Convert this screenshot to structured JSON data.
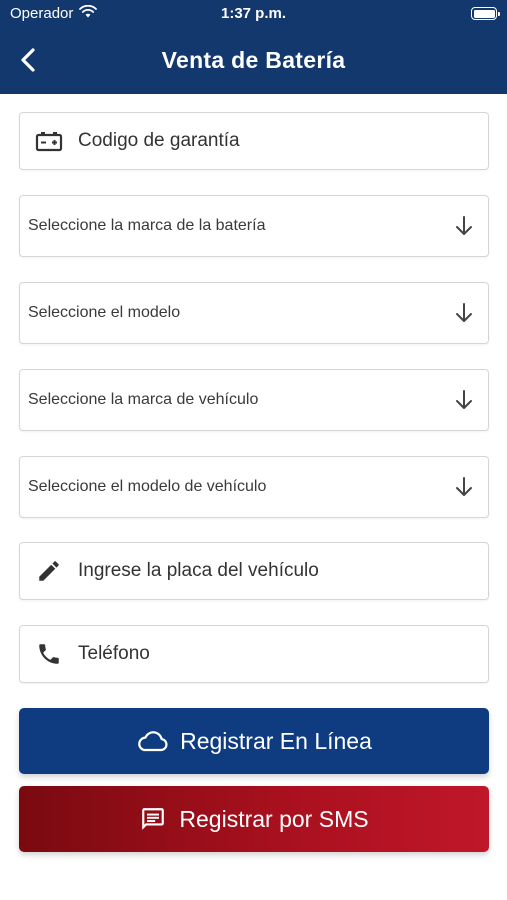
{
  "status_bar": {
    "carrier": "Operador",
    "time": "1:37 p.m."
  },
  "header": {
    "title": "Venta de Batería",
    "back_icon": "chevron-left-icon"
  },
  "form": {
    "warranty_code": {
      "placeholder": "Codigo de garantía",
      "icon": "battery-icon"
    },
    "battery_brand": {
      "placeholder": "Seleccione la marca de la batería",
      "icon": "arrow-down-icon"
    },
    "model": {
      "placeholder": "Seleccione el modelo",
      "icon": "arrow-down-icon"
    },
    "vehicle_brand": {
      "placeholder": "Seleccione la marca de vehículo",
      "icon": "arrow-down-icon"
    },
    "vehicle_model": {
      "placeholder": "Seleccione el modelo de vehículo",
      "icon": "arrow-down-icon"
    },
    "plate": {
      "placeholder": "Ingrese la placa del vehículo",
      "icon": "pencil-icon"
    },
    "phone": {
      "placeholder": "Teléfono",
      "icon": "phone-icon"
    }
  },
  "actions": {
    "register_online": {
      "label": "Registrar En Línea",
      "icon": "cloud-icon"
    },
    "register_sms": {
      "label": "Registrar por SMS",
      "icon": "message-icon"
    }
  },
  "colors": {
    "header": "#13386e",
    "primary_button": "#0f3c80",
    "sms_button": "#a8101e"
  }
}
